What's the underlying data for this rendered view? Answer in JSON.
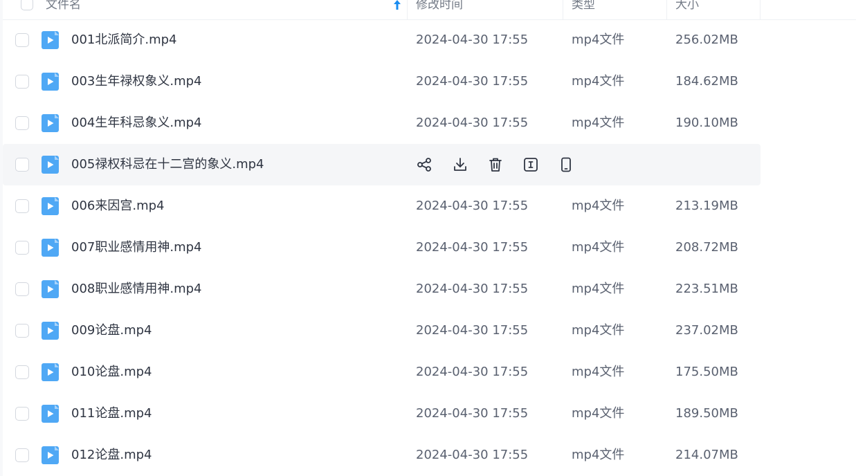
{
  "header": {
    "name_label": "文件名",
    "modified_label": "修改时间",
    "type_label": "类型",
    "size_label": "大小"
  },
  "hover_actions": [
    "share-icon",
    "download-icon",
    "trash-icon",
    "rename-icon",
    "phone-icon"
  ],
  "rows": [
    {
      "name": "001北派简介.mp4",
      "modified": "2024-04-30 17:55",
      "type": "mp4文件",
      "size": "256.02MB"
    },
    {
      "name": "003生年禄权象义.mp4",
      "modified": "2024-04-30 17:55",
      "type": "mp4文件",
      "size": "184.62MB"
    },
    {
      "name": "004生年科忌象义.mp4",
      "modified": "2024-04-30 17:55",
      "type": "mp4文件",
      "size": "190.10MB"
    },
    {
      "name": "005禄权科忌在十二宫的象义.mp4",
      "hovered": true
    },
    {
      "name": "006来因宫.mp4",
      "modified": "2024-04-30 17:55",
      "type": "mp4文件",
      "size": "213.19MB"
    },
    {
      "name": "007职业感情用神.mp4",
      "modified": "2024-04-30 17:55",
      "type": "mp4文件",
      "size": "208.72MB"
    },
    {
      "name": "008职业感情用神.mp4",
      "modified": "2024-04-30 17:55",
      "type": "mp4文件",
      "size": "223.51MB"
    },
    {
      "name": "009论盘.mp4",
      "modified": "2024-04-30 17:55",
      "type": "mp4文件",
      "size": "237.02MB"
    },
    {
      "name": "010论盘.mp4",
      "modified": "2024-04-30 17:55",
      "type": "mp4文件",
      "size": "175.50MB"
    },
    {
      "name": "011论盘.mp4",
      "modified": "2024-04-30 17:55",
      "type": "mp4文件",
      "size": "189.50MB"
    },
    {
      "name": "012论盘.mp4",
      "modified": "2024-04-30 17:55",
      "type": "mp4文件",
      "size": "214.07MB"
    }
  ],
  "colors": {
    "file_icon": "#4fa8f5",
    "sort_arrow": "#1a8cf0",
    "hover_row": "#f5f6f8"
  }
}
